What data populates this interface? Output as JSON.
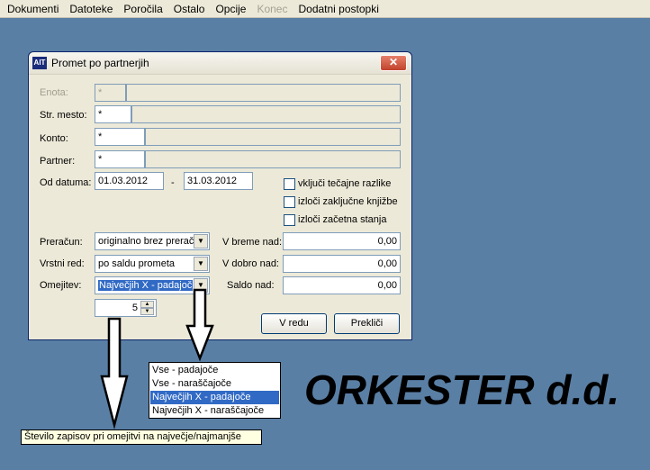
{
  "menu": [
    "Dokumenti",
    "Datoteke",
    "Poročila",
    "Ostalo",
    "Opcije",
    "Konec",
    "Dodatni postopki"
  ],
  "menu_disabled": "Konec",
  "dialog": {
    "app_icon": "AIT",
    "title": "Promet po partnerjih",
    "close_glyph": "✕",
    "labels": {
      "enota": "Enota:",
      "str_mesto": "Str. mesto:",
      "konto": "Konto:",
      "partner": "Partner:",
      "od_datuma": "Od datuma:",
      "dash": "-",
      "preracun": "Preračun:",
      "vrstni_red": "Vrstni red:",
      "omejitev": "Omejitev:",
      "v_breme_nad": "V breme nad:",
      "v_dobro_nad": "V dobro nad:",
      "saldo_nad": "Saldo nad:"
    },
    "values": {
      "enota": "*",
      "str_mesto": "*",
      "konto": "*",
      "partner": "*",
      "date_from": "01.03.2012",
      "date_to": "31.03.2012",
      "preracun": "originalno brez preraču",
      "vrstni_red": "po saldu prometa",
      "omejitev": "Največjih X - padajoč",
      "v_breme_nad": "0,00",
      "v_dobro_nad": "0,00",
      "saldo_nad": "0,00",
      "count": "5"
    },
    "checkboxes": [
      {
        "label": "vključi tečajne razlike",
        "checked": false
      },
      {
        "label": "izloči zaključne knjižbe",
        "checked": false
      },
      {
        "label": "izloči začetna stanja",
        "checked": false
      }
    ],
    "buttons": {
      "ok": "V redu",
      "cancel": "Prekliči"
    },
    "dropdown_arrow": "▼",
    "spin_up": "▲",
    "spin_down": "▼"
  },
  "dropdown_options": [
    "Vse - padajoče",
    "Vse - naraščajoče",
    "Največjih X - padajoče",
    "Največjih X - naraščajoče"
  ],
  "dropdown_selected_index": 2,
  "tooltip": "Število zapisov pri omejitvi na največje/najmanjše",
  "brand_text": "ORKESTER d.d.",
  "colors": {
    "desktop": "#5a7fa5",
    "selection": "#316ac5",
    "tooltip": "#ffffe1"
  }
}
